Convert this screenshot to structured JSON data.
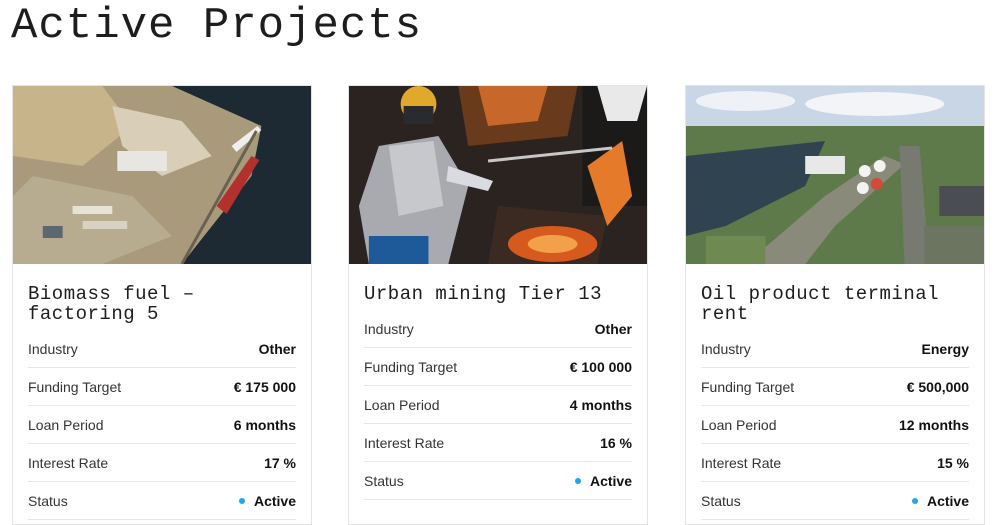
{
  "page": {
    "title": "Active Projects"
  },
  "labels": {
    "industry": "Industry",
    "funding_target": "Funding Target",
    "loan_period": "Loan Period",
    "interest_rate": "Interest Rate",
    "status": "Status"
  },
  "projects": [
    {
      "title": "Biomass fuel – factoring 5",
      "industry": "Other",
      "funding_target": "€ 175 000",
      "loan_period": "6 months",
      "interest_rate": "17 %",
      "status": "Active"
    },
    {
      "title": "Urban mining Tier 13",
      "industry": "Other",
      "funding_target": "€ 100 000",
      "loan_period": "4 months",
      "interest_rate": "16 %",
      "status": "Active"
    },
    {
      "title": "Oil product terminal rent",
      "industry": "Energy",
      "funding_target": "€ 500,000",
      "loan_period": "12 months",
      "interest_rate": "15 %",
      "status": "Active"
    }
  ],
  "colors": {
    "status_active": "#1ea7e4",
    "border": "#e4e4e4"
  }
}
